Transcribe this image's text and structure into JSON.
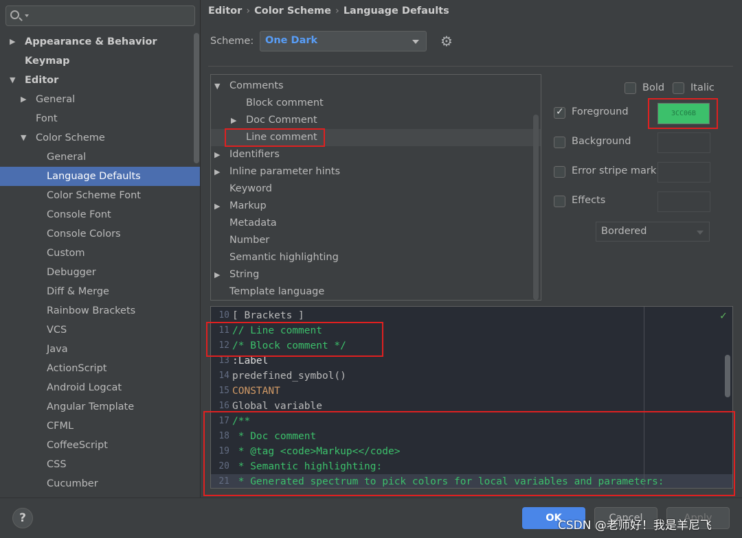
{
  "sidebar": {
    "search": {
      "value": "",
      "placeholder": ""
    },
    "items": [
      {
        "label": "Appearance & Behavior",
        "arrow": "▶"
      },
      {
        "label": "Keymap",
        "arrow": ""
      },
      {
        "label": "Editor",
        "arrow": "▼"
      },
      {
        "label": "General",
        "arrow": "▶"
      },
      {
        "label": "Font",
        "arrow": ""
      },
      {
        "label": "Color Scheme",
        "arrow": "▼"
      },
      {
        "label": "General",
        "arrow": ""
      },
      {
        "label": "Language Defaults",
        "arrow": ""
      },
      {
        "label": "Color Scheme Font",
        "arrow": ""
      },
      {
        "label": "Console Font",
        "arrow": ""
      },
      {
        "label": "Console Colors",
        "arrow": ""
      },
      {
        "label": "Custom",
        "arrow": ""
      },
      {
        "label": "Debugger",
        "arrow": ""
      },
      {
        "label": "Diff & Merge",
        "arrow": ""
      },
      {
        "label": "Rainbow Brackets",
        "arrow": ""
      },
      {
        "label": "VCS",
        "arrow": ""
      },
      {
        "label": "Java",
        "arrow": ""
      },
      {
        "label": "ActionScript",
        "arrow": ""
      },
      {
        "label": "Android Logcat",
        "arrow": ""
      },
      {
        "label": "Angular Template",
        "arrow": ""
      },
      {
        "label": "CFML",
        "arrow": ""
      },
      {
        "label": "CoffeeScript",
        "arrow": ""
      },
      {
        "label": "CSS",
        "arrow": ""
      },
      {
        "label": "Cucumber",
        "arrow": ""
      }
    ]
  },
  "breadcrumb": [
    "Editor",
    "Color Scheme",
    "Language Defaults"
  ],
  "breadcrumb_separator": "›",
  "scheme": {
    "label": "Scheme:",
    "value": "One Dark"
  },
  "attributes": [
    {
      "label": "Comments",
      "arrow": "▼"
    },
    {
      "label": "Block comment",
      "arrow": ""
    },
    {
      "label": "Doc Comment",
      "arrow": "▶"
    },
    {
      "label": "Line comment",
      "arrow": ""
    },
    {
      "label": "Identifiers",
      "arrow": "▶"
    },
    {
      "label": "Inline parameter hints",
      "arrow": "▶"
    },
    {
      "label": "Keyword",
      "arrow": ""
    },
    {
      "label": "Markup",
      "arrow": "▶"
    },
    {
      "label": "Metadata",
      "arrow": ""
    },
    {
      "label": "Number",
      "arrow": ""
    },
    {
      "label": "Semantic highlighting",
      "arrow": ""
    },
    {
      "label": "String",
      "arrow": "▶"
    },
    {
      "label": "Template language",
      "arrow": ""
    }
  ],
  "options": {
    "bold": {
      "label": "Bold",
      "checked": false
    },
    "italic": {
      "label": "Italic",
      "checked": false
    },
    "foreground": {
      "label": "Foreground",
      "checked": true,
      "color_hex": "3CC06B",
      "color": "#3cc06b"
    },
    "background": {
      "label": "Background",
      "checked": false
    },
    "error_stripe": {
      "label": "Error stripe mark",
      "checked": false
    },
    "effects": {
      "label": "Effects",
      "checked": false
    },
    "effects_type": "Bordered"
  },
  "preview_lines": [
    {
      "num": "10",
      "text": "[ Brackets ]",
      "color": "#bbbbbb"
    },
    {
      "num": "11",
      "text": "// Line comment",
      "color": "#3cc06b"
    },
    {
      "num": "12",
      "text": "/* Block comment */",
      "color": "#3cc06b"
    },
    {
      "num": "13",
      "text": ":Label",
      "color": "#dddddd"
    },
    {
      "num": "14",
      "text": "predefined_symbol()",
      "color": "#bbbbbb"
    },
    {
      "num": "15",
      "text": "CONSTANT",
      "color": "#d19a66"
    },
    {
      "num": "16",
      "text": "Global variable",
      "color": "#bbbbbb"
    },
    {
      "num": "17",
      "text": "/**",
      "color": "#3cc06b"
    },
    {
      "num": "18",
      "text": " * Doc comment",
      "color": "#3cc06b"
    },
    {
      "num": "19",
      "text": " * @tag <code>Markup<</code>",
      "color": "#3cc06b"
    },
    {
      "num": "20",
      "text": " * Semantic highlighting:",
      "color": "#3cc06b"
    },
    {
      "num": "21",
      "text": " * Generated spectrum to pick colors for local variables and parameters:",
      "color": "#3cc06b"
    }
  ],
  "buttons": {
    "help": "?",
    "ok": "OK",
    "cancel": "Cancel",
    "apply": "Apply"
  },
  "watermark": "CSDN @老师好！我是羊尼飞"
}
